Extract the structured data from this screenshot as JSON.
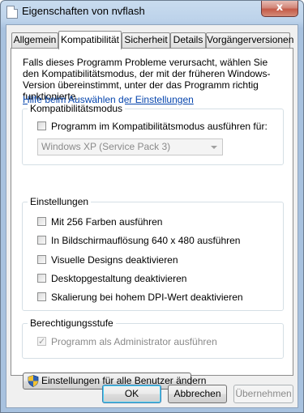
{
  "window": {
    "title": "Eigenschaften von nvflash",
    "close_label": "x",
    "icons": {
      "app": "document-icon",
      "close": "close-icon",
      "shield": "uac-shield-icon"
    }
  },
  "tabs": [
    {
      "label": "Allgemein",
      "active": false
    },
    {
      "label": "Kompatibilität",
      "active": true
    },
    {
      "label": "Sicherheit",
      "active": false
    },
    {
      "label": "Details",
      "active": false
    },
    {
      "label": "Vorgängerversionen",
      "active": false
    }
  ],
  "intro": {
    "text": "Falls dieses Programm Probleme verursacht, wählen Sie den Kompatibilitätsmodus, der mit der früheren Windows- Version übereinstimmt, unter der das Programm richtig funktionierte.",
    "help_link": "Hilfe beim Auswählen der Einstellungen"
  },
  "compat_mode": {
    "group_label": "Kompatibilitätsmodus",
    "checkbox_label": "Programm im Kompatibilitätsmodus ausführen für:",
    "checked": false,
    "os_selected": "Windows XP (Service Pack 3)"
  },
  "settings": {
    "group_label": "Einstellungen",
    "options": [
      {
        "label": "Mit 256 Farben ausführen",
        "checked": false
      },
      {
        "label": "In Bildschirmauflösung 640 x 480 ausführen",
        "checked": false
      },
      {
        "label": "Visuelle Designs deaktivieren",
        "checked": false
      },
      {
        "label": "Desktopgestaltung deaktivieren",
        "checked": false
      },
      {
        "label": "Skalierung bei hohem DPI-Wert deaktivieren",
        "checked": false
      }
    ]
  },
  "privilege": {
    "group_label": "Berechtigungsstufe",
    "checkbox_label": "Programm als Administrator ausführen",
    "checked": true,
    "disabled": true
  },
  "all_users_button": "Einstellungen für alle Benutzer ändern",
  "buttons": {
    "ok": "OK",
    "cancel": "Abbrechen",
    "apply": "Übernehmen"
  }
}
